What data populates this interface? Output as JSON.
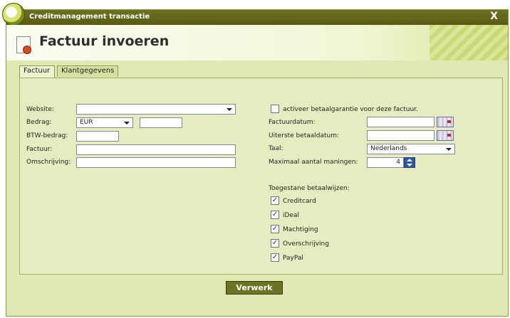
{
  "window": {
    "title": "Creditmanagement transactie",
    "close_label": "X"
  },
  "header": {
    "title": "Factuur invoeren"
  },
  "tabs": [
    {
      "label": "Factuur",
      "active": true
    },
    {
      "label": "Klantgegevens",
      "active": false
    }
  ],
  "left_form": {
    "website": {
      "label": "Website:",
      "value": ""
    },
    "bedrag": {
      "label": "Bedrag:",
      "currency": "EUR",
      "value": ""
    },
    "btw": {
      "label": "BTW-bedrag:",
      "value": ""
    },
    "factuur": {
      "label": "Factuur:",
      "value": ""
    },
    "omschrijving": {
      "label": "Omschrijving:",
      "value": ""
    }
  },
  "right_form": {
    "guarantee_label": "activeer betaalgarantie voor deze factuur.",
    "guarantee_checked": false,
    "factuurdatum": {
      "label": "Factuurdatum:",
      "value": ""
    },
    "uiterste": {
      "label": "Uiterste betaaldatum:",
      "value": ""
    },
    "taal": {
      "label": "Taal:",
      "value": "Nederlands"
    },
    "maningen": {
      "label": "Maximaal aantal maningen:",
      "value": "4"
    },
    "methods_heading": "Toegestane betaalwijzen:",
    "methods": [
      {
        "label": "Creditcard",
        "checked": true
      },
      {
        "label": "iDeal",
        "checked": true
      },
      {
        "label": "Machtiging",
        "checked": true
      },
      {
        "label": "Overschrijving",
        "checked": true
      },
      {
        "label": "PayPal",
        "checked": true
      }
    ]
  },
  "submit_label": "Verwerk",
  "colors": {
    "titlebar": "#5f6418",
    "panel": "#e6ecbf",
    "button": "#6b7321",
    "spinner": "#2d57a7"
  }
}
